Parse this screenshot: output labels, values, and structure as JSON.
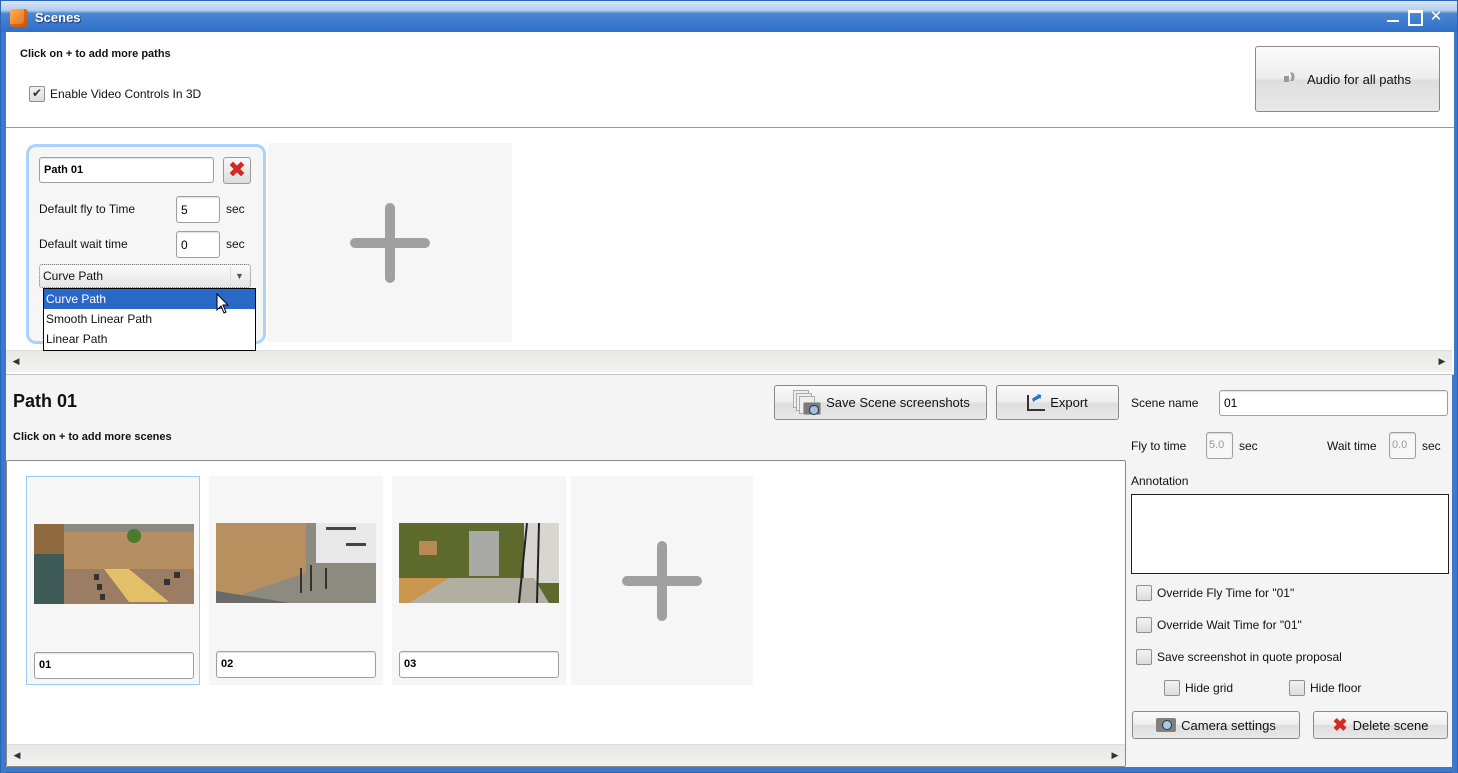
{
  "window": {
    "title": "Scenes",
    "controls": {
      "minimize": "minimize",
      "maximize": "maximize",
      "close": "✕"
    }
  },
  "top": {
    "hint": "Click on + to add more paths",
    "enable_video_label": "Enable Video Controls In 3D",
    "enable_video_checked": true,
    "audio_button_label": "Audio for all paths"
  },
  "path_card": {
    "name": "Path 01",
    "fly_label": "Default fly to Time",
    "fly_value": "5",
    "wait_label": "Default wait time",
    "wait_value": "0",
    "unit": "sec",
    "path_type_selected": "Curve Path",
    "path_type_options": [
      "Curve Path",
      "Smooth Linear Path",
      "Linear Path"
    ]
  },
  "path_section": {
    "title": "Path 01",
    "hint": "Click on + to add more scenes",
    "save_screenshots_label": "Save Scene screenshots",
    "export_label": "Export"
  },
  "scenes": [
    {
      "name": "01",
      "selected": true,
      "thumb_desc": "conference room"
    },
    {
      "name": "02",
      "selected": false,
      "thumb_desc": "office wall"
    },
    {
      "name": "03",
      "selected": false,
      "thumb_desc": "elevator lobby"
    }
  ],
  "scene_props": {
    "scene_name_label": "Scene name",
    "scene_name_value": "01",
    "fly_time_label": "Fly to time",
    "fly_time_value": "5.0",
    "wait_time_label": "Wait time",
    "wait_time_value": "0.0",
    "unit": "sec",
    "annotation_label": "Annotation",
    "annotation_value": "",
    "override_fly_label": "Override Fly Time for \"01\"",
    "override_wait_label": "Override Wait Time for \"01\"",
    "save_quote_label": "Save screenshot in quote proposal",
    "hide_grid_label": "Hide grid",
    "hide_floor_label": "Hide floor",
    "camera_settings_label": "Camera settings",
    "delete_scene_label": "Delete scene"
  }
}
